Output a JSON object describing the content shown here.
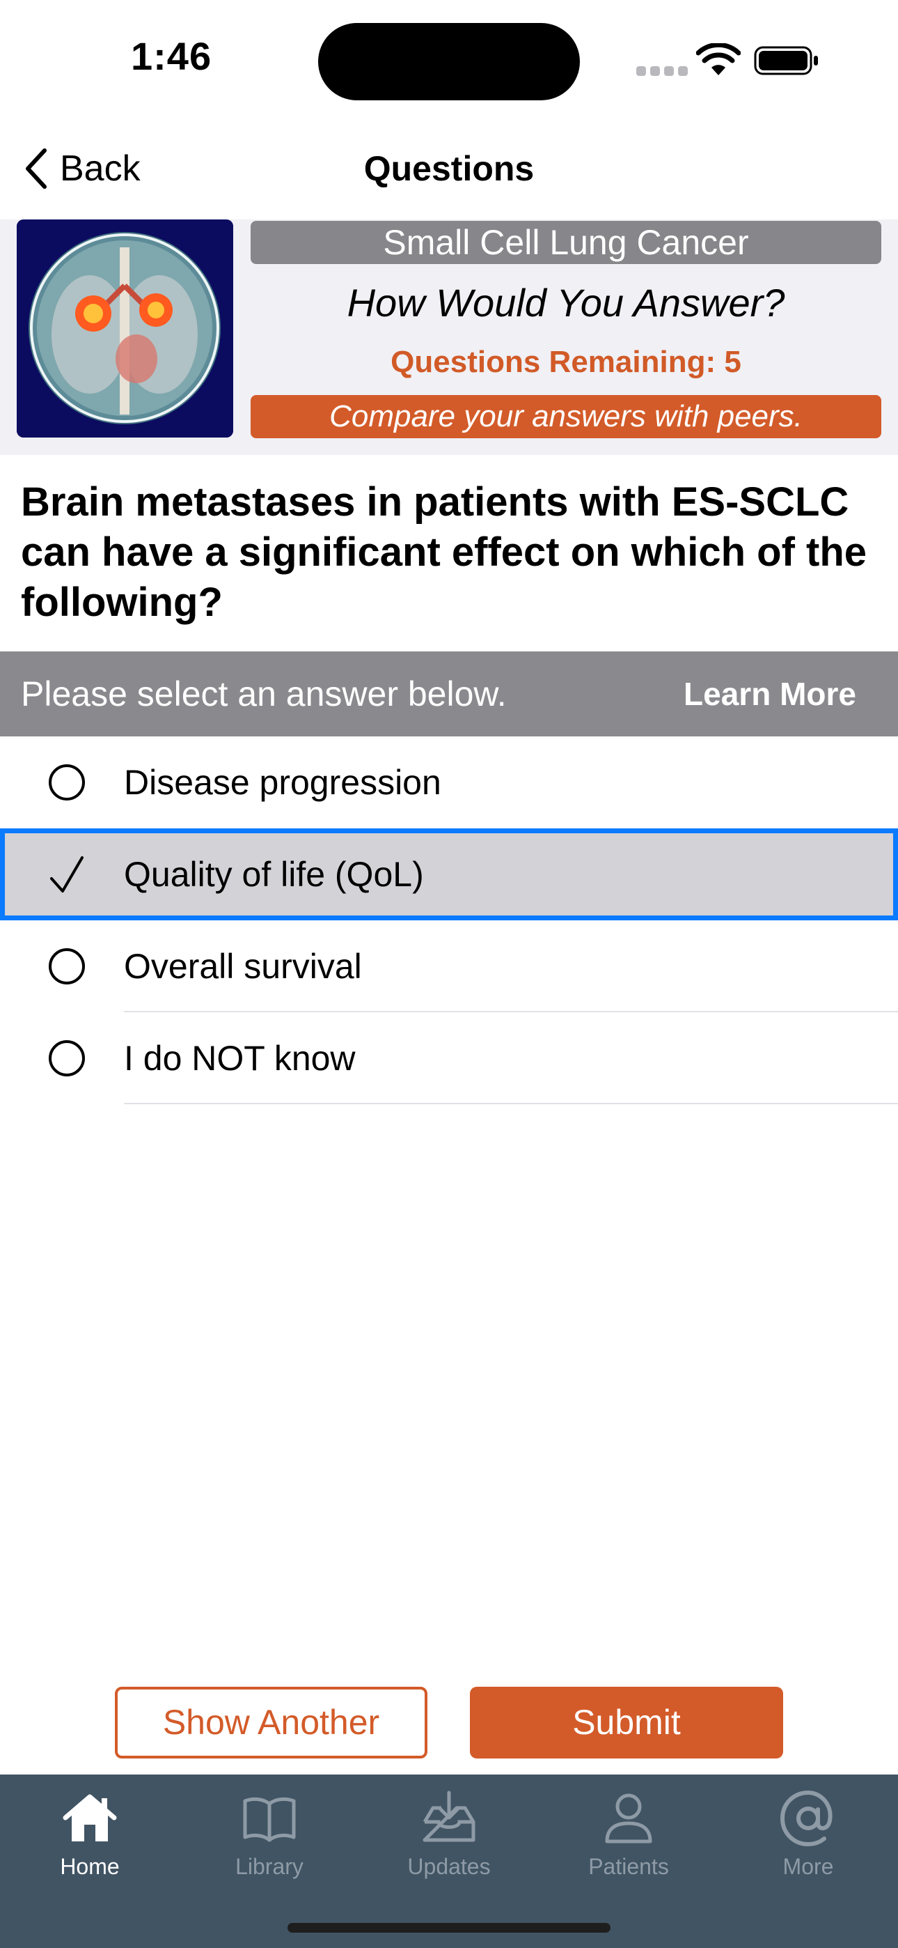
{
  "status_bar": {
    "time": "1:46"
  },
  "nav": {
    "back_label": "Back",
    "title": "Questions"
  },
  "header": {
    "topic": "Small Cell Lung Cancer",
    "prompt": "How Would You Answer?",
    "remaining": "Questions Remaining: 5",
    "compare": "Compare your answers with peers."
  },
  "question": "Brain metastases in patients with ES-SCLC can have a significant effect on which of the following?",
  "select_bar": {
    "instruction": "Please select an answer below.",
    "learn_more": "Learn More"
  },
  "answers": [
    {
      "label": "Disease progression",
      "selected": false
    },
    {
      "label": "Quality of life (QoL)",
      "selected": true
    },
    {
      "label": "Overall survival",
      "selected": false
    },
    {
      "label": "I do NOT know",
      "selected": false
    }
  ],
  "buttons": {
    "show_another": "Show Another",
    "submit": "Submit"
  },
  "tabs": [
    {
      "label": "Home",
      "icon": "house-icon",
      "active": true
    },
    {
      "label": "Library",
      "icon": "book-icon",
      "active": false
    },
    {
      "label": "Updates",
      "icon": "inbox-download-icon",
      "active": false
    },
    {
      "label": "Patients",
      "icon": "person-icon",
      "active": false
    },
    {
      "label": "More",
      "icon": "at-sign-icon",
      "active": false
    }
  ],
  "colors": {
    "accent": "#d35b29",
    "tab_bar": "#415463",
    "selection_border": "#0a7aff",
    "topic_pill": "#86868b"
  }
}
